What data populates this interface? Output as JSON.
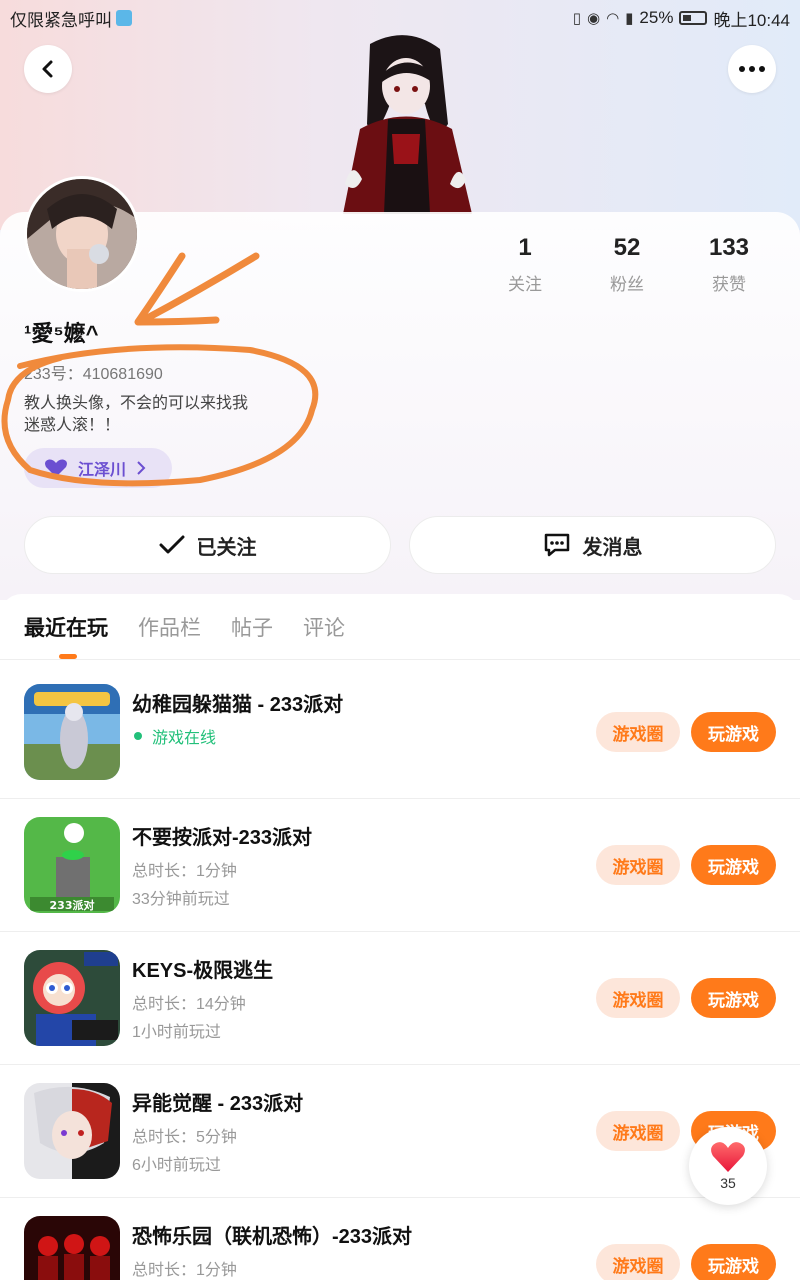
{
  "status_bar": {
    "carrier": "仅限紧急呼叫",
    "battery": "25%",
    "time": "晚上10:44"
  },
  "profile": {
    "username": "¹愛⁵嬷^",
    "uid": "233号：410681690",
    "bio_line1": "教人换头像，不会的可以来找我",
    "bio_line2": "迷惑人滚！！",
    "tag_label": "江泽川"
  },
  "stats": [
    {
      "value": "1",
      "label": "关注"
    },
    {
      "value": "52",
      "label": "粉丝"
    },
    {
      "value": "133",
      "label": "获赞"
    }
  ],
  "actions": {
    "follow_label": "已关注",
    "message_label": "发消息"
  },
  "tabs": [
    "最近在玩",
    "作品栏",
    "帖子",
    "评论"
  ],
  "games": [
    {
      "title": "幼稚园躲猫猫 - 233派对",
      "status": "游戏在线",
      "meta1": "",
      "meta2": "",
      "circle_label": "游戏圈",
      "play_label": "玩游戏"
    },
    {
      "title": "不要按派对-233派对",
      "status": "",
      "meta1": "总时长：1分钟",
      "meta2": "33分钟前玩过",
      "circle_label": "游戏圈",
      "play_label": "玩游戏"
    },
    {
      "title": "KEYS-极限逃生",
      "status": "",
      "meta1": "总时长：14分钟",
      "meta2": "1小时前玩过",
      "circle_label": "游戏圈",
      "play_label": "玩游戏"
    },
    {
      "title": "异能觉醒 - 233派对",
      "status": "",
      "meta1": "总时长：5分钟",
      "meta2": "6小时前玩过",
      "circle_label": "游戏圈",
      "play_label": "玩游戏"
    },
    {
      "title": "恐怖乐园（联机恐怖）-233派对",
      "status": "",
      "meta1": "总时长：1分钟",
      "meta2": "",
      "circle_label": "游戏圈",
      "play_label": "玩游戏"
    }
  ],
  "fab": {
    "count": "35",
    "icon": "heart-icon"
  },
  "colors": {
    "accent": "#ff7a1a",
    "online": "#22c07a",
    "tag": "#6b4fd1",
    "annotation": "#f08a3c"
  }
}
